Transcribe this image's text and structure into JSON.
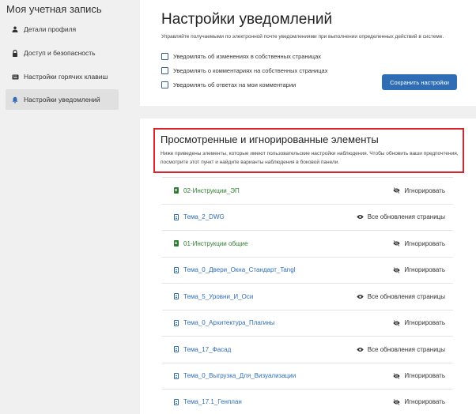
{
  "sidebar": {
    "title": "Моя учетная запись",
    "items": [
      {
        "label": "Детали профиля",
        "icon": "user-icon"
      },
      {
        "label": "Доступ и безопасность",
        "icon": "lock-icon"
      },
      {
        "label": "Настройки горячих клавиш",
        "icon": "keyboard-icon"
      },
      {
        "label": "Настройки уведомлений",
        "icon": "bell-icon",
        "active": true
      }
    ]
  },
  "notifications": {
    "title": "Настройки уведомлений",
    "description": "Управляйте получаемыми по электронной почте уведомлениями при выполнении определенных действий в системе.",
    "options": [
      {
        "label": "Уведомлять об изменениях в собственных страницах",
        "checked": false
      },
      {
        "label": "Уведомлять о комментариях на собственных страницах",
        "checked": false
      },
      {
        "label": "Уведомлять об ответах на мои комментарии",
        "checked": false
      }
    ],
    "save_label": "Сохранить настройки"
  },
  "watched": {
    "title": "Просмотренные и игнорированные элементы",
    "description": "Ниже приведены элементы, которые имеют пользовательские настройки наблюдения. Чтобы обновить ваши предпочтения, посмотрите этот пункт и найдите варианты наблюдения в боковой панели.",
    "items": [
      {
        "name": "02-Инструкции_ЭП",
        "type": "green",
        "status": "Игнорировать",
        "status_icon": "eye-slash-icon"
      },
      {
        "name": "Тема_2_DWG",
        "type": "blue",
        "status": "Все обновления страницы",
        "status_icon": "eye-icon"
      },
      {
        "name": "01-Инструкции общие",
        "type": "green",
        "status": "Игнорировать",
        "status_icon": "eye-slash-icon"
      },
      {
        "name": "Тема_0_Двери_Окна_Стандарт_Tangl",
        "type": "blue",
        "status": "Игнорировать",
        "status_icon": "eye-slash-icon"
      },
      {
        "name": "Тема_5_Уровни_И_Оси",
        "type": "blue",
        "status": "Все обновления страницы",
        "status_icon": "eye-icon"
      },
      {
        "name": "Тема_0_Архитектура_Плагины",
        "type": "blue",
        "status": "Игнорировать",
        "status_icon": "eye-slash-icon"
      },
      {
        "name": "Тема_17_Фасад",
        "type": "blue",
        "status": "Все обновления страницы",
        "status_icon": "eye-icon"
      },
      {
        "name": "Тема_0_Выгрузка_Для_Визуализации",
        "type": "blue",
        "status": "Игнорировать",
        "status_icon": "eye-slash-icon"
      },
      {
        "name": "Тема_17.1_Генплан",
        "type": "blue",
        "status": "Игнорировать",
        "status_icon": "eye-slash-icon"
      }
    ]
  },
  "colors": {
    "accent": "#2f6db5",
    "green_link": "#2e7d32",
    "highlight_border": "#d9232d"
  }
}
